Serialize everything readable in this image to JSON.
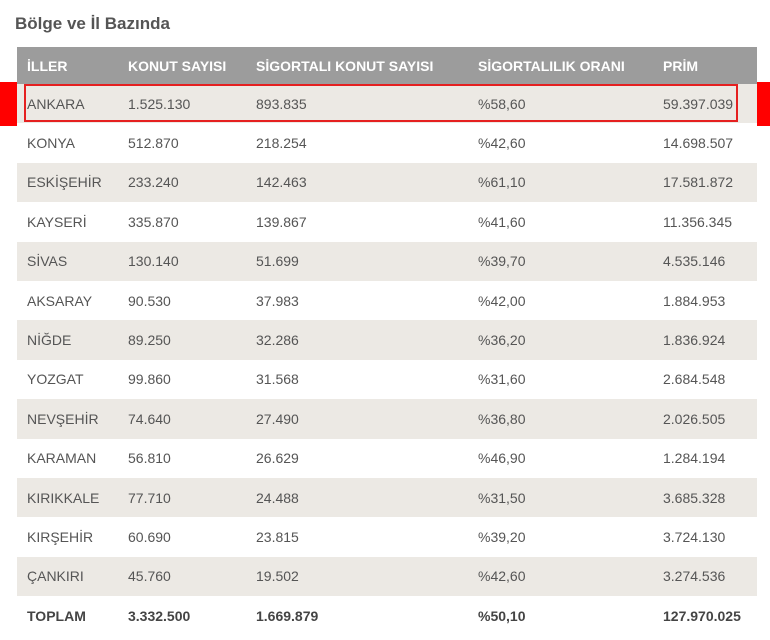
{
  "section_title": "Bölge ve İl Bazında",
  "table": {
    "headers": [
      "İLLER",
      "KONUT SAYISI",
      "SİGORTALI KONUT SAYISI",
      "SİGORTALILIK ORANI",
      "PRİM"
    ],
    "rows": [
      [
        "ANKARA",
        "1.525.130",
        "893.835",
        "%58,60",
        "59.397.039"
      ],
      [
        "KONYA",
        "512.870",
        "218.254",
        "%42,60",
        "14.698.507"
      ],
      [
        "ESKİŞEHİR",
        "233.240",
        "142.463",
        "%61,10",
        "17.581.872"
      ],
      [
        "KAYSERİ",
        "335.870",
        "139.867",
        "%41,60",
        "11.356.345"
      ],
      [
        "SİVAS",
        "130.140",
        "51.699",
        "%39,70",
        "4.535.146"
      ],
      [
        "AKSARAY",
        "90.530",
        "37.983",
        "%42,00",
        "1.884.953"
      ],
      [
        "NİĞDE",
        "89.250",
        "32.286",
        "%36,20",
        "1.836.924"
      ],
      [
        "YOZGAT",
        "99.860",
        "31.568",
        "%31,60",
        "2.684.548"
      ],
      [
        "NEVŞEHİR",
        "74.640",
        "27.490",
        "%36,80",
        "2.026.505"
      ],
      [
        "KARAMAN",
        "56.810",
        "26.629",
        "%46,90",
        "1.284.194"
      ],
      [
        "KIRIKKALE",
        "77.710",
        "24.488",
        "%31,50",
        "3.685.328"
      ],
      [
        "KIRŞEHİR",
        "60.690",
        "23.815",
        "%39,20",
        "3.724.130"
      ],
      [
        "ÇANKIRI",
        "45.760",
        "19.502",
        "%42,60",
        "3.274.536"
      ]
    ],
    "total": [
      "TOPLAM",
      "3.332.500",
      "1.669.879",
      "%50,10",
      "127.970.025"
    ]
  },
  "colors": {
    "header_bg": "#9c9c9c",
    "stripe_bg": "#ece9e4",
    "highlight": "#e52020"
  }
}
